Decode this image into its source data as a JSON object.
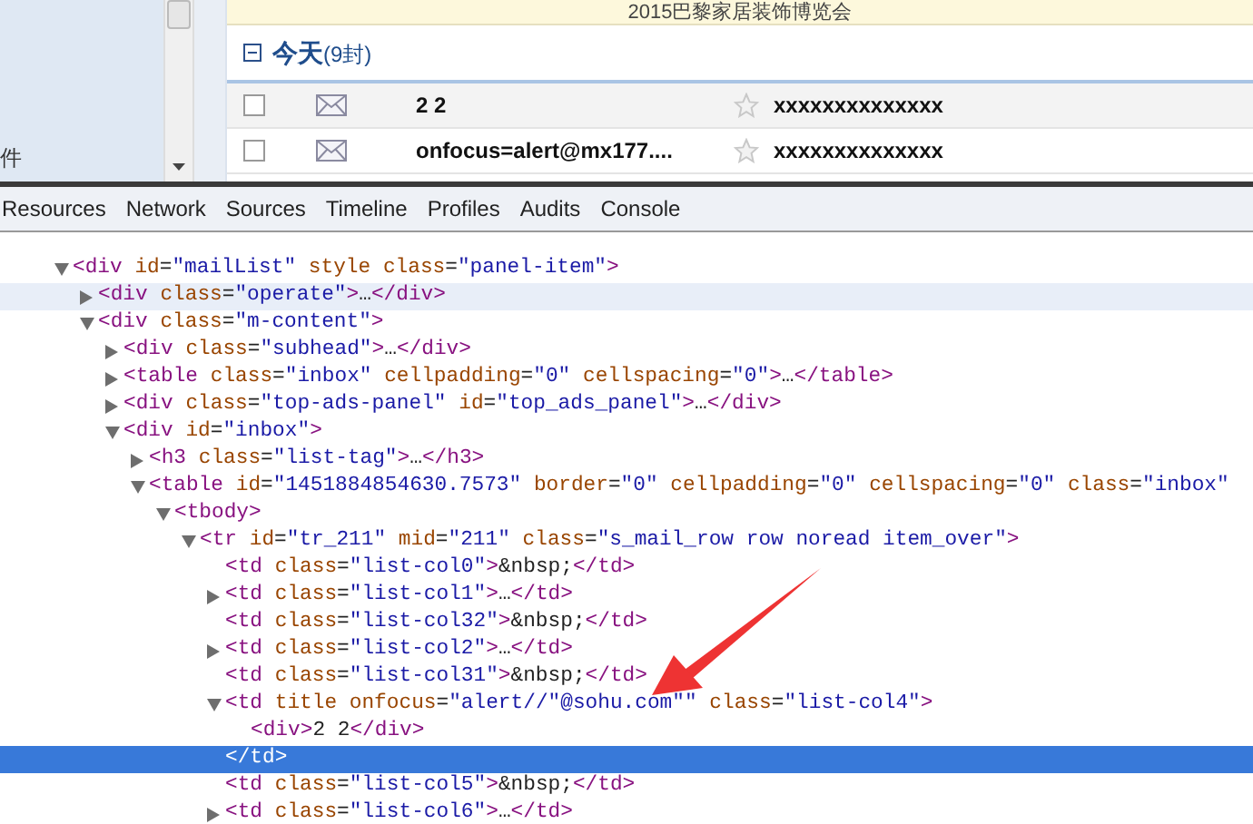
{
  "page": {
    "banner": "2015巴黎家居装饰博览会",
    "sidebar_text": "件",
    "group": {
      "title": "今天",
      "count": "(9封)",
      "expanded": true
    },
    "mails": [
      {
        "checked": false,
        "subject": "2 2",
        "starred": false,
        "sender": "xxxxxxxxxxxxxx",
        "highlighted": true
      },
      {
        "checked": false,
        "subject": "onfocus=alert@mx177....",
        "starred": false,
        "sender": "xxxxxxxxxxxxxx",
        "highlighted": false
      }
    ]
  },
  "devtools": {
    "tabs": [
      "Resources",
      "Network",
      "Sources",
      "Timeline",
      "Profiles",
      "Audits",
      "Console"
    ],
    "nodes": [
      {
        "kind": "expanded",
        "text": "<div id=\"mailList\" style class=\"panel-item\">",
        "hovered": false,
        "selected": false,
        "children": [
          {
            "kind": "collapsed",
            "text": "<div class=\"operate\">…</div>",
            "hovered": true,
            "selected": false
          },
          {
            "kind": "expanded",
            "text": "<div class=\"m-content\">",
            "hovered": false,
            "selected": false,
            "children": [
              {
                "kind": "collapsed",
                "text": "<div class=\"subhead\">…</div>",
                "hovered": false,
                "selected": false
              },
              {
                "kind": "collapsed",
                "text": "<table class=\"inbox\" cellpadding=\"0\" cellspacing=\"0\">…</table>",
                "hovered": false,
                "selected": false
              },
              {
                "kind": "collapsed",
                "text": "<div class=\"top-ads-panel\" id=\"top_ads_panel\">…</div>",
                "hovered": false,
                "selected": false
              },
              {
                "kind": "expanded",
                "text": "<div id=\"inbox\">",
                "hovered": false,
                "selected": false,
                "children": [
                  {
                    "kind": "collapsed",
                    "text": "<h3 class=\"list-tag\">…</h3>",
                    "hovered": false,
                    "selected": false
                  },
                  {
                    "kind": "expanded",
                    "text": "<table id=\"1451884854630.7573\" border=\"0\" cellpadding=\"0\" cellspacing=\"0\" class=\"inbox\"",
                    "hovered": false,
                    "selected": false,
                    "children": [
                      {
                        "kind": "expanded",
                        "text": "<tbody>",
                        "hovered": false,
                        "selected": false,
                        "children": [
                          {
                            "kind": "expanded",
                            "text": "<tr id=\"tr_211\" mid=\"211\" class=\"s_mail_row row noread item_over\">",
                            "hovered": false,
                            "selected": false,
                            "children": [
                              {
                                "kind": "leaf",
                                "text": "<td class=\"list-col0\">&nbsp;</td>",
                                "hovered": false,
                                "selected": false
                              },
                              {
                                "kind": "collapsed",
                                "text": "<td class=\"list-col1\">…</td>",
                                "hovered": false,
                                "selected": false
                              },
                              {
                                "kind": "leaf",
                                "text": "<td class=\"list-col32\">&nbsp;</td>",
                                "hovered": false,
                                "selected": false
                              },
                              {
                                "kind": "collapsed",
                                "text": "<td class=\"list-col2\">…</td>",
                                "hovered": false,
                                "selected": false
                              },
                              {
                                "kind": "leaf",
                                "text": "<td class=\"list-col31\">&nbsp;</td>",
                                "hovered": false,
                                "selected": false
                              },
                              {
                                "kind": "expanded",
                                "text": "<td title onfocus=\"alert//\"@sohu.com\"\" class=\"list-col4\">",
                                "hovered": false,
                                "selected": false,
                                "children": [
                                  {
                                    "kind": "leaf",
                                    "text": "<div>2 2</div>",
                                    "hovered": false,
                                    "selected": false
                                  }
                                ],
                                "closing": {
                                  "text": "</td>",
                                  "selected": true
                                }
                              },
                              {
                                "kind": "leaf",
                                "text": "<td class=\"list-col5\">&nbsp;</td>",
                                "hovered": false,
                                "selected": false
                              },
                              {
                                "kind": "collapsed",
                                "text": "<td class=\"list-col6\">…</td>",
                                "hovered": false,
                                "selected": false
                              }
                            ]
                          }
                        ]
                      }
                    ]
                  }
                ]
              }
            ]
          }
        ]
      }
    ]
  }
}
